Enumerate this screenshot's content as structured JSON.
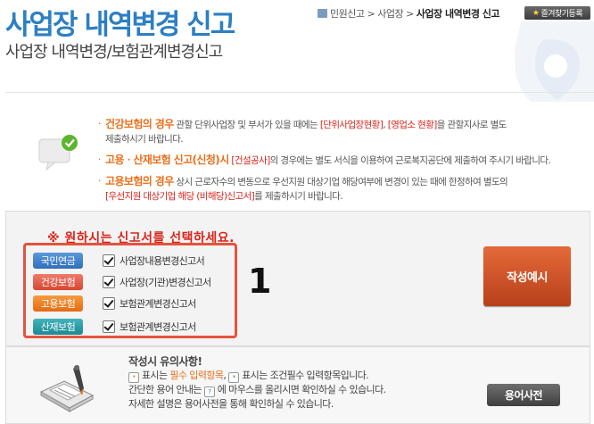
{
  "page": {
    "title": "사업장 내역변경 신고",
    "subtitle": "사업장 내역변경/보험관계변경신고"
  },
  "breadcrumb": {
    "items": [
      "민원신고",
      "사업장",
      "사업장 내역변경 신고"
    ],
    "separator": ">"
  },
  "favorites_button": {
    "label": "즐겨찾기등록",
    "icon": "star-icon"
  },
  "notices": [
    {
      "heading": "건강보험의 경우",
      "text1": "관할 단위사업장 및 부서가 있을 때에는 ",
      "red1": "[단위사업장현황]",
      "text2": ", ",
      "red2": "[영업소 현황]",
      "text3": "을 관할지사로 별도",
      "line2": "제출하시기 바랍니다."
    },
    {
      "heading": "고용ㆍ산재보험 신고(신청)시",
      "red1": "[건설공사]",
      "text1": "의 경우에는 별도 서식을 이용하여 근로복지공단에 제출하여 주시기 바랍니다."
    },
    {
      "heading": "고용보험의 경우",
      "text1": "상시 근로자수의 변동으로 우선지원 대상기업 해당여부에 변경이 있는 때에 한정하여 별도의",
      "red1": "[우선지원 대상기업 해당 (비해당)신고서]",
      "text2": "를 제출하시기 바랍니다."
    }
  ],
  "selection": {
    "prompt": "※ 원하시는 신고서를 선택하세요.",
    "number_label": "1",
    "items": [
      {
        "badge": "국민연금",
        "label": "사업장내용변경신고서",
        "checked": true,
        "color": "#3a7fcf"
      },
      {
        "badge": "건강보험",
        "label": "사업장(기관)변경신고서",
        "checked": true,
        "color": "#e2573f"
      },
      {
        "badge": "고용보험",
        "label": "보험관계변경신고서",
        "checked": true,
        "color": "#ee7d22"
      },
      {
        "badge": "산재보험",
        "label": "보험관계변경신고서",
        "checked": true,
        "color": "#2a9ea6"
      }
    ]
  },
  "write_button": {
    "label": "작성예시"
  },
  "info": {
    "title": "작성시 유의사항!",
    "line1_a": "표시는 ",
    "line1_req": "필수 입력항목",
    "line1_b": ", ",
    "line1_c": "표시는 조건필수 입력항목입니다.",
    "line2_a": "간단한 용어 안내는 ",
    "line2_b": " 에 마우스를 올리시면 확인하실 수 있습니다.",
    "line3": "자세한 설명은 용어사전을 통해 확인하실 수 있습니다.",
    "req_mark": "*",
    "cond_mark": "*",
    "help_mark": "?"
  },
  "dictionary_button": {
    "label": "용어사전"
  },
  "colors": {
    "title": "#2d7fc2",
    "accent": "#e8701c",
    "alert": "#d8251c",
    "frame": "#e5533d"
  }
}
